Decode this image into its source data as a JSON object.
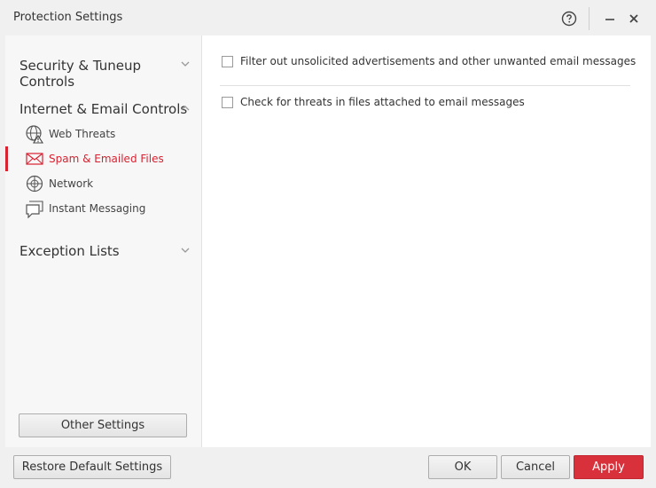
{
  "window": {
    "title": "Protection Settings"
  },
  "sidebar": {
    "sections": [
      {
        "label": "Security & Tuneup Controls",
        "expanded": false
      },
      {
        "label": "Internet & Email Controls",
        "expanded": true
      },
      {
        "label": "Exception Lists",
        "expanded": false
      }
    ],
    "items": [
      {
        "label": "Web Threats",
        "icon": "globe-warning-icon",
        "active": false
      },
      {
        "label": "Spam & Emailed Files",
        "icon": "envelope-icon",
        "active": true
      },
      {
        "label": "Network",
        "icon": "network-globe-icon",
        "active": false
      },
      {
        "label": "Instant Messaging",
        "icon": "chat-bubble-icon",
        "active": false
      }
    ],
    "other_settings_label": "Other Settings"
  },
  "main": {
    "options": [
      {
        "label": "Filter out unsolicited advertisements and other unwanted email messages",
        "checked": false
      },
      {
        "label": "Check for threats in files attached to email messages",
        "checked": false
      }
    ]
  },
  "footer": {
    "restore_label": "Restore Default Settings",
    "ok_label": "OK",
    "cancel_label": "Cancel",
    "apply_label": "Apply"
  },
  "colors": {
    "accent": "#d92231",
    "apply_button": "#d8313b"
  }
}
